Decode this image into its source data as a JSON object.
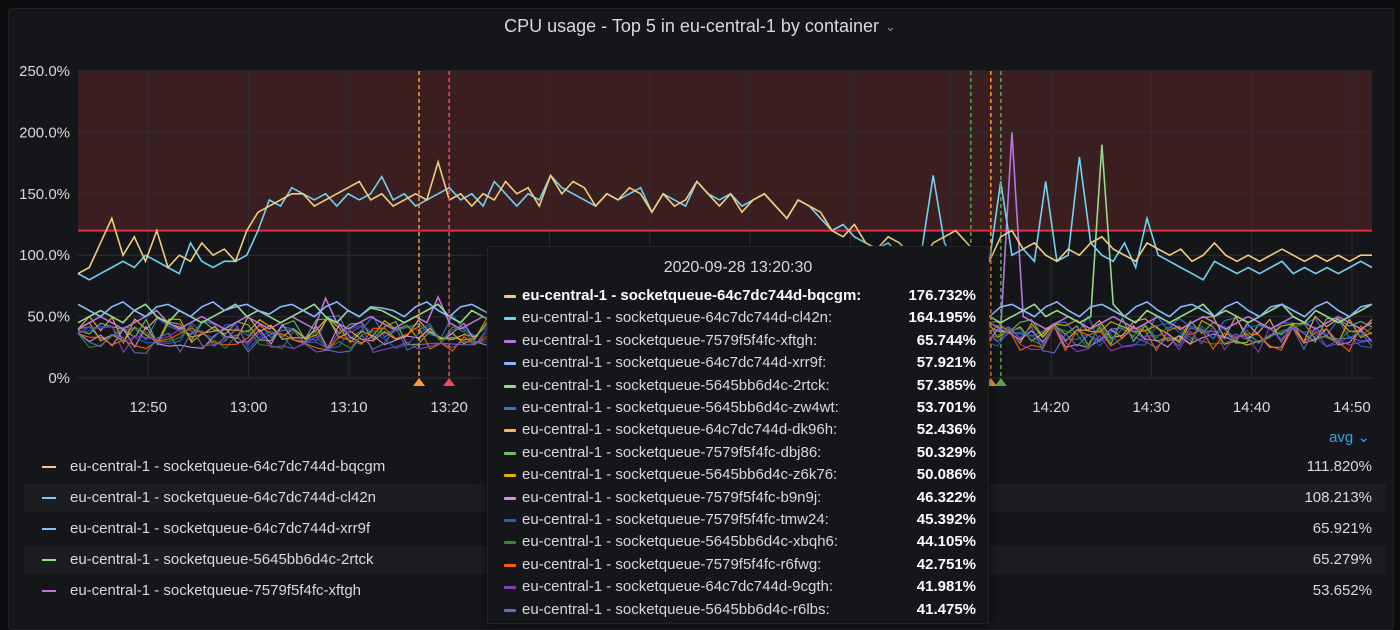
{
  "panel": {
    "title": "CPU usage - Top 5 in eu-central-1 by container"
  },
  "chart_data": {
    "type": "line",
    "yaxis": {
      "ticks": [
        "0%",
        "50.0%",
        "100.0%",
        "150.0%",
        "200.0%",
        "250.0%"
      ],
      "range": [
        0,
        250
      ]
    },
    "xaxis": {
      "ticks": [
        "12:50",
        "13:00",
        "13:10",
        "13:20",
        "13:30",
        "13:40",
        "13:50",
        "14:00",
        "14:10",
        "14:20",
        "14:30",
        "14:40",
        "14:50"
      ]
    },
    "threshold": {
      "value": 120,
      "color": "#e02f44",
      "fill": "#3b1e20"
    },
    "annotations": [
      {
        "time": "13:17",
        "color": "#ff9830"
      },
      {
        "time": "13:20",
        "color": "#f2495c"
      },
      {
        "time": "14:12",
        "color": "#56a64b"
      },
      {
        "time": "14:14",
        "color": "#ff9830"
      },
      {
        "time": "14:15",
        "color": "#56a64b"
      }
    ],
    "series": [
      {
        "name": "eu-central-1 - socketqueue-64c7dc744d-bqcgm",
        "color": "#f2cc7a",
        "values": [
          85,
          90,
          110,
          130,
          100,
          115,
          95,
          120,
          90,
          100,
          95,
          110,
          100,
          105,
          95,
          120,
          135,
          140,
          145,
          150,
          150,
          140,
          145,
          150,
          155,
          160,
          145,
          150,
          140,
          145,
          150,
          145,
          176,
          145,
          150,
          140,
          150,
          145,
          160,
          150,
          155,
          140,
          165,
          150,
          160,
          155,
          140,
          150,
          145,
          155,
          150,
          135,
          150,
          140,
          145,
          160,
          150,
          140,
          150,
          135,
          145,
          150,
          140,
          130,
          145,
          140,
          135,
          120,
          115,
          125,
          110,
          105,
          115,
          110,
          100,
          95,
          110,
          115,
          120,
          110,
          100,
          95,
          115,
          120,
          105,
          110,
          100,
          95,
          105,
          100,
          110,
          115,
          105,
          100,
          95,
          110,
          105,
          100,
          105,
          95,
          100,
          110,
          100,
          95,
          100,
          95,
          100,
          105,
          100,
          95,
          100,
          95,
          100,
          95,
          100,
          100
        ]
      },
      {
        "name": "eu-central-1 - socketqueue-64c7dc744d-cl42n",
        "color": "#73d0f0",
        "values": [
          85,
          80,
          85,
          90,
          95,
          90,
          100,
          95,
          90,
          85,
          110,
          95,
          90,
          95,
          95,
          100,
          120,
          145,
          140,
          155,
          150,
          145,
          150,
          140,
          150,
          145,
          150,
          164,
          145,
          150,
          140,
          145,
          150,
          155,
          145,
          150,
          140,
          160,
          150,
          140,
          150,
          145,
          165,
          155,
          150,
          145,
          140,
          150,
          145,
          150,
          155,
          135,
          150,
          145,
          140,
          160,
          150,
          145,
          150,
          140,
          145,
          150,
          140,
          130,
          145,
          140,
          130,
          120,
          125,
          115,
          110,
          105,
          110,
          100,
          95,
          105,
          165,
          110,
          95,
          100,
          90,
          95,
          160,
          100,
          105,
          95,
          160,
          95,
          100,
          180,
          110,
          100,
          95,
          110,
          90,
          130,
          100,
          95,
          90,
          85,
          80,
          95,
          90,
          85,
          90,
          85,
          90,
          95,
          85,
          90,
          85,
          90,
          85,
          90,
          95,
          90
        ]
      },
      {
        "name": "eu-central-1 - socketqueue-64c7dc744d-xrr9f",
        "color": "#8ab8ff",
        "values": [
          60,
          55,
          50,
          58,
          62,
          55,
          50,
          58,
          60,
          55,
          50,
          58,
          62,
          55,
          58,
          60,
          55,
          52,
          58,
          60,
          55,
          50,
          58,
          62,
          55,
          50,
          58,
          57,
          55,
          50,
          58,
          62,
          55,
          50,
          58,
          60,
          55,
          50,
          58,
          62,
          55,
          50,
          58,
          60,
          55,
          50,
          58,
          62,
          55,
          50,
          58,
          60,
          55,
          50,
          58,
          62,
          55,
          50,
          58,
          60,
          55,
          50,
          58,
          62,
          55,
          50,
          58,
          60,
          55,
          50,
          58,
          62,
          55,
          50,
          58,
          60,
          55,
          50,
          58,
          62,
          55,
          50,
          58,
          60,
          55,
          50,
          58,
          62,
          55,
          50,
          58,
          60,
          55,
          50,
          58,
          62,
          55,
          50,
          58,
          60,
          55,
          50,
          58,
          62,
          55,
          50,
          58,
          60,
          55,
          50,
          58,
          62,
          55,
          50,
          58,
          60
        ]
      },
      {
        "name": "eu-central-1 - socketqueue-5645bb6d4c-2rtck",
        "color": "#96d98d",
        "values": [
          45,
          50,
          55,
          50,
          45,
          55,
          60,
          50,
          45,
          55,
          50,
          45,
          50,
          55,
          60,
          50,
          55,
          50,
          45,
          50,
          55,
          60,
          50,
          45,
          55,
          50,
          57,
          55,
          50,
          45,
          50,
          55,
          60,
          50,
          45,
          55,
          50,
          45,
          50,
          55,
          60,
          50,
          55,
          50,
          45,
          50,
          55,
          60,
          50,
          45,
          55,
          50,
          45,
          50,
          55,
          60,
          50,
          55,
          50,
          45,
          50,
          55,
          60,
          50,
          45,
          55,
          50,
          45,
          50,
          55,
          60,
          50,
          55,
          50,
          45,
          50,
          55,
          60,
          50,
          45,
          55,
          50,
          45,
          50,
          55,
          60,
          50,
          55,
          50,
          45,
          50,
          190,
          60,
          50,
          45,
          55,
          50,
          45,
          50,
          55,
          60,
          50,
          55,
          50,
          45,
          50,
          55,
          60,
          50,
          45,
          55,
          50,
          45,
          50,
          55,
          60
        ]
      },
      {
        "name": "eu-central-1 - socketqueue-7579f5f4fc-xftgh",
        "color": "#b877d9",
        "values": [
          40,
          45,
          50,
          45,
          40,
          45,
          50,
          55,
          45,
          40,
          45,
          50,
          45,
          40,
          45,
          50,
          45,
          40,
          45,
          50,
          45,
          40,
          65,
          45,
          40,
          45,
          50,
          45,
          40,
          45,
          50,
          45,
          66,
          45,
          40,
          45,
          50,
          45,
          40,
          45,
          50,
          45,
          40,
          45,
          50,
          45,
          40,
          45,
          50,
          45,
          40,
          45,
          50,
          45,
          40,
          45,
          50,
          45,
          40,
          45,
          50,
          45,
          40,
          45,
          50,
          45,
          40,
          45,
          50,
          45,
          40,
          45,
          50,
          45,
          40,
          45,
          50,
          45,
          40,
          45,
          50,
          45,
          40,
          200,
          50,
          45,
          40,
          45,
          50,
          45,
          40,
          45,
          50,
          45,
          40,
          45,
          50,
          45,
          40,
          45,
          50,
          45,
          40,
          45,
          50,
          45,
          40,
          45,
          50,
          45,
          40,
          45,
          50,
          45,
          40,
          45
        ]
      }
    ]
  },
  "tooltip": {
    "time": "2020-09-28 13:20:30",
    "rows": [
      {
        "name": "eu-central-1 - socketqueue-64c7dc744d-bqcgm:",
        "value": "176.732%",
        "color": "#f2cc7a",
        "highlight": true
      },
      {
        "name": "eu-central-1 - socketqueue-64c7dc744d-cl42n:",
        "value": "164.195%",
        "color": "#73d0f0"
      },
      {
        "name": "eu-central-1 - socketqueue-7579f5f4fc-xftgh:",
        "value": "65.744%",
        "color": "#b877d9"
      },
      {
        "name": "eu-central-1 - socketqueue-64c7dc744d-xrr9f:",
        "value": "57.921%",
        "color": "#8ab8ff"
      },
      {
        "name": "eu-central-1 - socketqueue-5645bb6d4c-2rtck:",
        "value": "57.385%",
        "color": "#96d98d"
      },
      {
        "name": "eu-central-1 - socketqueue-5645bb6d4c-zw4wt:",
        "value": "53.701%",
        "color": "#3274d9"
      },
      {
        "name": "eu-central-1 - socketqueue-64c7dc744d-dk96h:",
        "value": "52.436%",
        "color": "#ffb357"
      },
      {
        "name": "eu-central-1 - socketqueue-7579f5f4fc-dbj86:",
        "value": "50.329%",
        "color": "#73bf69"
      },
      {
        "name": "eu-central-1 - socketqueue-5645bb6d4c-z6k76:",
        "value": "50.086%",
        "color": "#e0b400"
      },
      {
        "name": "eu-central-1 - socketqueue-7579f5f4fc-b9n9j:",
        "value": "46.322%",
        "color": "#de8ee8"
      },
      {
        "name": "eu-central-1 - socketqueue-7579f5f4fc-tmw24:",
        "value": "45.392%",
        "color": "#1f60c4"
      },
      {
        "name": "eu-central-1 - socketqueue-5645bb6d4c-xbqh6:",
        "value": "44.105%",
        "color": "#37872d"
      },
      {
        "name": "eu-central-1 - socketqueue-7579f5f4fc-r6fwg:",
        "value": "42.751%",
        "color": "#fa6400"
      },
      {
        "name": "eu-central-1 - socketqueue-64c7dc744d-9cgth:",
        "value": "41.981%",
        "color": "#8f3bb8"
      },
      {
        "name": "eu-central-1 - socketqueue-5645bb6d4c-r6lbs:",
        "value": "41.475%",
        "color": "#5f6fbf"
      }
    ]
  },
  "legend": {
    "sort_label": "avg",
    "rows": [
      {
        "name": "eu-central-1 - socketqueue-64c7dc744d-bqcgm",
        "value": "111.820%",
        "color": "#f2cc7a"
      },
      {
        "name": "eu-central-1 - socketqueue-64c7dc744d-cl42n",
        "value": "108.213%",
        "color": "#73d0f0"
      },
      {
        "name": "eu-central-1 - socketqueue-64c7dc744d-xrr9f",
        "value": "65.921%",
        "color": "#8ab8ff"
      },
      {
        "name": "eu-central-1 - socketqueue-5645bb6d4c-2rtck",
        "value": "65.279%",
        "color": "#96d98d"
      },
      {
        "name": "eu-central-1 - socketqueue-7579f5f4fc-xftgh",
        "value": "53.652%",
        "color": "#b877d9"
      }
    ]
  }
}
